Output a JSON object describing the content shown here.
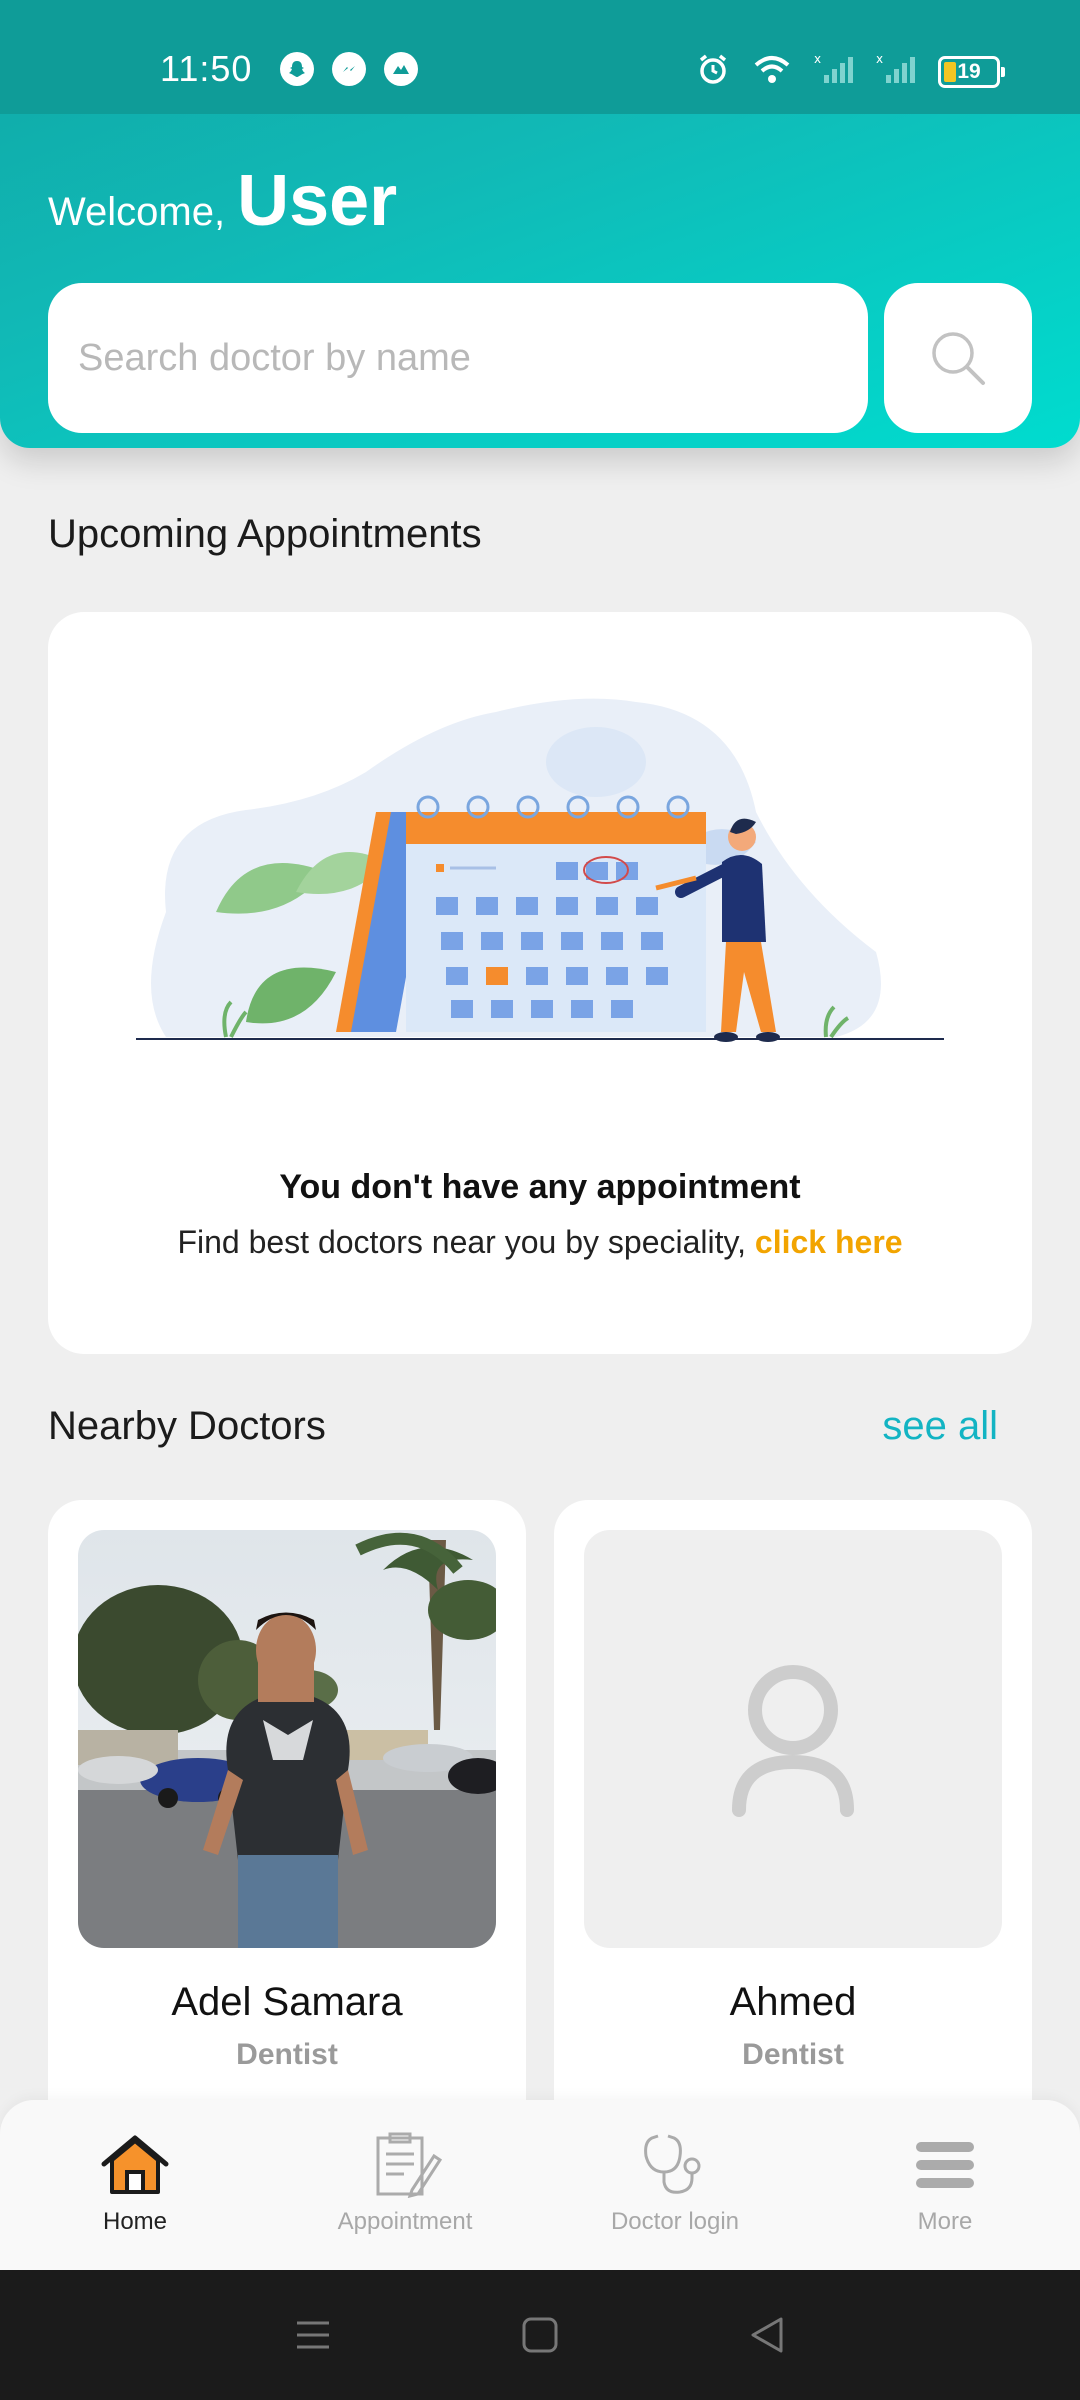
{
  "status_bar": {
    "time": "11:50",
    "battery": "19",
    "icons_left": [
      "snapchat-icon",
      "messenger-icon",
      "app-icon"
    ],
    "icons_right": [
      "alarm-icon",
      "wifi-icon",
      "signal-1-icon",
      "signal-2-icon",
      "battery-icon"
    ]
  },
  "header": {
    "welcome": "Welcome,",
    "user": "User",
    "search_placeholder": "Search doctor by name"
  },
  "appointments": {
    "title": "Upcoming Appointments",
    "empty_title": "You don't have any appointment",
    "empty_sub": "Find best doctors near you by speciality,",
    "link_text": "click here"
  },
  "nearby": {
    "title": "Nearby Doctors",
    "see_all": "see all",
    "doctors": [
      {
        "name": "Adel Samara",
        "speciality": "Dentist"
      },
      {
        "name": "Ahmed",
        "speciality": "Dentist"
      }
    ]
  },
  "bottom_nav": [
    {
      "label": "Home",
      "icon": "home-icon",
      "active": true
    },
    {
      "label": "Appointment",
      "icon": "clipboard-icon",
      "active": false
    },
    {
      "label": "Doctor login",
      "icon": "stethoscope-icon",
      "active": false
    },
    {
      "label": "More",
      "icon": "menu-icon",
      "active": false
    }
  ],
  "colors": {
    "accent": "#13b4c3",
    "header_start": "#10a8a6",
    "header_end": "#00dccf",
    "link": "#f2a400",
    "home_icon": "#f6922b"
  }
}
